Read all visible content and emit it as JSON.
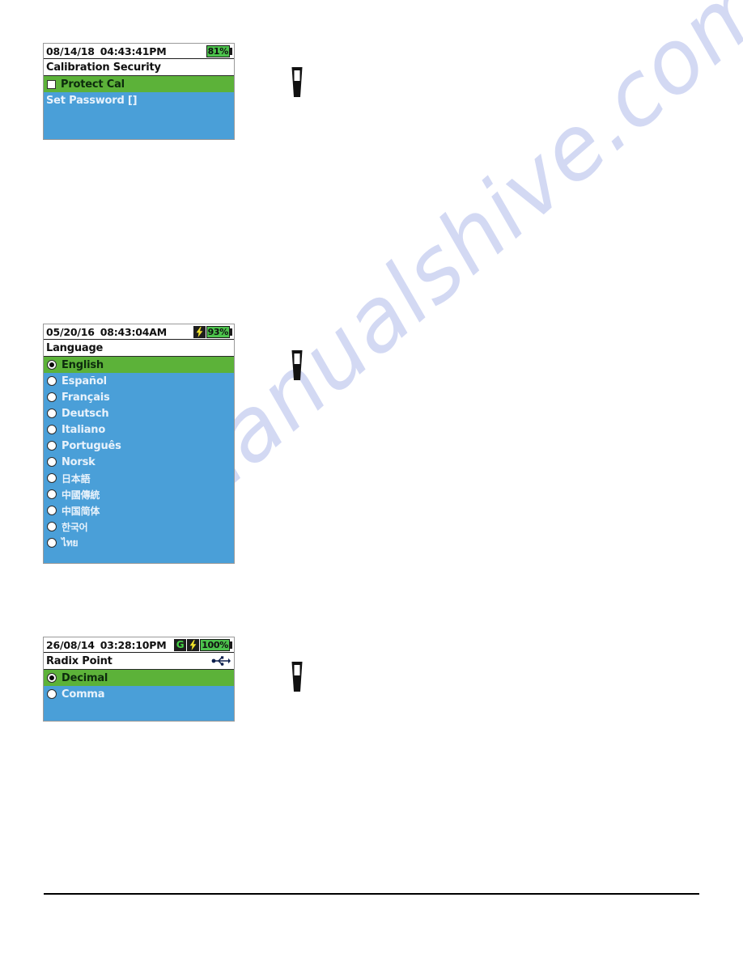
{
  "page": {
    "watermark_text": "manualshive.com",
    "background_color": "#ffffff",
    "footer_rule_color": "#000000"
  },
  "theme": {
    "screen_blue": "#4a9fd8",
    "selected_green": "#5cb239",
    "battery_green": "#4cc24c",
    "status_bg": "#ffffff",
    "label_light": "#e8f2fb"
  },
  "screens": [
    {
      "id": "calibration-security",
      "status": {
        "date": "08/14/18",
        "time": "04:43:41PM",
        "battery_percent": "81%",
        "charging_icon": false,
        "g_icon": false,
        "g_label": "G"
      },
      "title": "Calibration Security",
      "usb_icon": false,
      "rows": [
        {
          "control": "checkbox",
          "checked": false,
          "label": "Protect Cal",
          "selected": true
        },
        {
          "control": "none",
          "label": "Set Password []",
          "selected": false
        }
      ]
    },
    {
      "id": "language",
      "status": {
        "date": "05/20/16",
        "time": "08:43:04AM",
        "battery_percent": "93%",
        "charging_icon": true,
        "g_icon": false,
        "g_label": "G"
      },
      "title": "Language",
      "usb_icon": false,
      "rows": [
        {
          "control": "radio",
          "checked": true,
          "label": "English",
          "selected": true
        },
        {
          "control": "radio",
          "checked": false,
          "label": "Español",
          "selected": false
        },
        {
          "control": "radio",
          "checked": false,
          "label": "Français",
          "selected": false
        },
        {
          "control": "radio",
          "checked": false,
          "label": "Deutsch",
          "selected": false
        },
        {
          "control": "radio",
          "checked": false,
          "label": "Italiano",
          "selected": false
        },
        {
          "control": "radio",
          "checked": false,
          "label": "Português",
          "selected": false
        },
        {
          "control": "radio",
          "checked": false,
          "label": "Norsk",
          "selected": false
        },
        {
          "control": "radio",
          "checked": false,
          "label": "日本語",
          "selected": false,
          "cjk": true
        },
        {
          "control": "radio",
          "checked": false,
          "label": "中國傳統",
          "selected": false,
          "cjk": true
        },
        {
          "control": "radio",
          "checked": false,
          "label": "中国简体",
          "selected": false,
          "cjk": true
        },
        {
          "control": "radio",
          "checked": false,
          "label": "한국어",
          "selected": false,
          "cjk": true
        },
        {
          "control": "radio",
          "checked": false,
          "label": "ไทย",
          "selected": false,
          "cjk": true
        }
      ]
    },
    {
      "id": "radix-point",
      "status": {
        "date": "26/08/14",
        "time": "03:28:10PM",
        "battery_percent": "100%",
        "charging_icon": true,
        "g_icon": true,
        "g_label": "G"
      },
      "title": "Radix Point",
      "usb_icon": true,
      "rows": [
        {
          "control": "radio",
          "checked": true,
          "label": "Decimal",
          "selected": true
        },
        {
          "control": "radio",
          "checked": false,
          "label": "Comma",
          "selected": false
        }
      ]
    }
  ],
  "device_glyphs": [
    {
      "id": "device-glyph-1"
    },
    {
      "id": "device-glyph-2"
    },
    {
      "id": "device-glyph-3"
    }
  ]
}
